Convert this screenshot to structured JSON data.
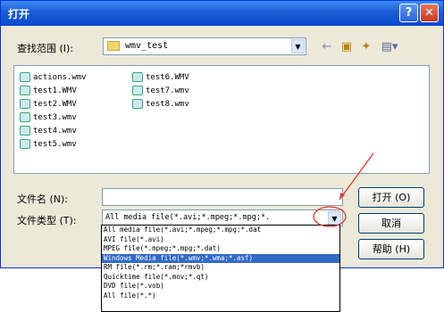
{
  "window": {
    "title": "打开"
  },
  "lookin": {
    "label": "查找范围 (I):",
    "value": "wmv_test"
  },
  "toolbar": {
    "back_icon": "back-arrow-icon",
    "up_icon": "up-folder-icon",
    "new_icon": "new-folder-icon",
    "view_icon": "view-menu-icon"
  },
  "files": [
    {
      "name": "actions.wmv"
    },
    {
      "name": "test1.WMV"
    },
    {
      "name": "test2.WMV"
    },
    {
      "name": "test3.wmv"
    },
    {
      "name": "test4.wmv"
    },
    {
      "name": "test5.wmv"
    },
    {
      "name": "test6.WMV"
    },
    {
      "name": "test7.wmv"
    },
    {
      "name": "test8.wmv"
    }
  ],
  "filename": {
    "label": "文件名 (N):",
    "value": ""
  },
  "filetype": {
    "label": "文件类型 (T):",
    "value": "All media file(*.avi;*.mpeg;*.mpg;*.",
    "options": [
      "All media file(*.avi;*.mpeg;*.mpg;*.dat",
      "AVI file(*.avi)",
      "MPEG file(*.mpeg;*.mpg;*.dat)",
      "Windows Media file(*.wmv;*.wma;*.asf)",
      "RM file(*.rm;*.ram;*rmvb)",
      "Quicktime file(*.mov;*.qt)",
      "DVD file(*.vob)",
      "All file(*.*)"
    ],
    "selected_index": 3
  },
  "buttons": {
    "open": "打开 (O)",
    "cancel": "取消",
    "help": "帮助 (H)"
  },
  "colors": {
    "annotation": "#e0392f",
    "selection": "#316ac5"
  }
}
